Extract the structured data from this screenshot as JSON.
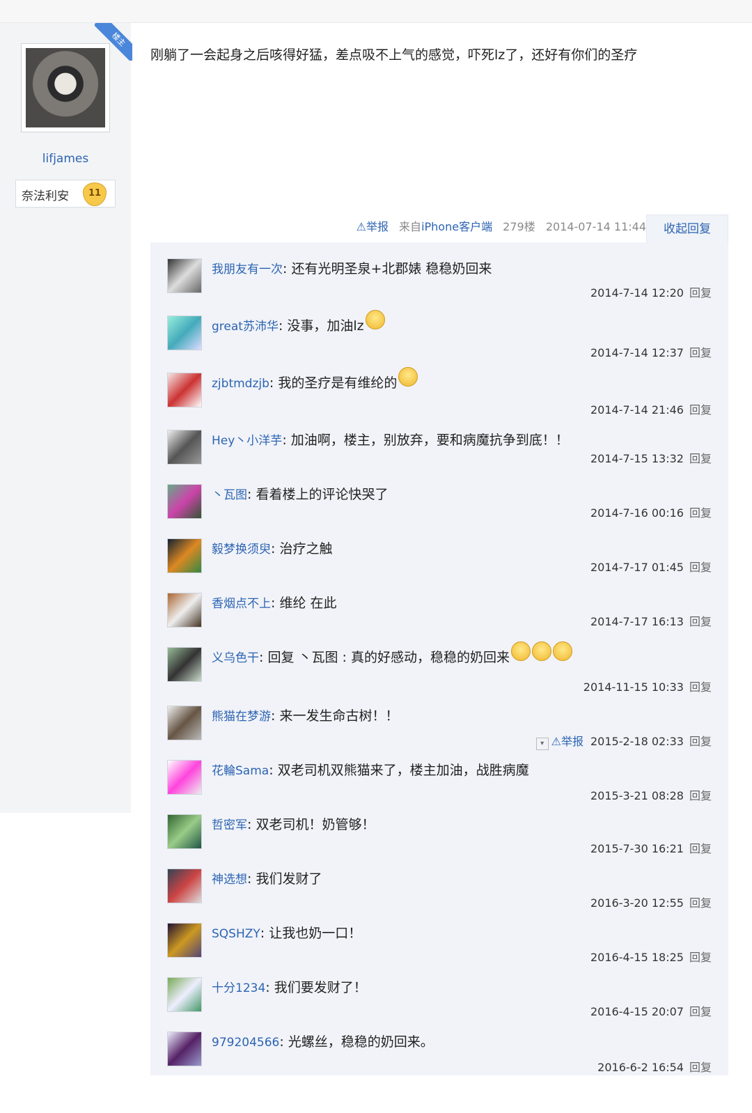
{
  "author": {
    "lz_tag": "楼主",
    "username": "lifjames",
    "badge_name": "奈法利安",
    "badge_level": "11"
  },
  "post": {
    "content": "刚躺了一会起身之后咳得好猛，差点吸不上气的感觉，吓死lz了，还好有你们的圣疗",
    "report": "举报",
    "source_prefix": "来自",
    "source_client": "iPhone客户端",
    "floor": "279楼",
    "time": "2014-07-14 11:44",
    "collapse": "收起回复"
  },
  "reply_label": "回复",
  "replies": [
    {
      "name": "我朋友有一次",
      "text": ": 还有光明圣泉+北郡婊 稳稳奶回来",
      "time": "2014-7-14 12:20"
    },
    {
      "name": "great苏沛华",
      "text": ": 没事，加油lz",
      "time": "2014-7-14 12:37",
      "emoji": "angry-emoji"
    },
    {
      "name": "zjbtmdzjb",
      "text": ": 我的圣疗是有维纶的",
      "time": "2014-7-14 21:46",
      "emoji": "smile-emoji"
    },
    {
      "name": "Hey丶小洋芋",
      "text": ": 加油啊，楼主，别放弃，要和病魔抗争到底！！",
      "time": "2014-7-15 13:32"
    },
    {
      "name": "丶瓦图",
      "text": ": 看着楼上的评论快哭了",
      "time": "2014-7-16 00:16"
    },
    {
      "name": "毅梦换须臾",
      "text": ": 治疗之触",
      "time": "2014-7-17 01:45"
    },
    {
      "name": "香烟点不上",
      "text": ": 维纶 在此",
      "time": "2014-7-17 16:13"
    },
    {
      "name": "义乌色干",
      "text": ": 回复 丶瓦图 : 真的好感动，稳稳的奶回来",
      "time": "2014-11-15 10:33",
      "emoji": "cry-emoji"
    },
    {
      "name": "熊猫在梦游",
      "text": ": 来一发生命古树！！",
      "time": "2015-2-18 02:33",
      "report": "举报"
    },
    {
      "name": "花輪Sama",
      "text": ": 双老司机双熊猫来了，楼主加油，战胜病魔",
      "time": "2015-3-21 08:28"
    },
    {
      "name": "哲密军",
      "text": ": 双老司机！奶管够！",
      "time": "2015-7-30 16:21"
    },
    {
      "name": "神选想",
      "text": ": 我们发财了",
      "time": "2016-3-20 12:55"
    },
    {
      "name": "SQSHZY",
      "text": ": 让我也奶一口！",
      "time": "2016-4-15 18:25"
    },
    {
      "name": "十分1234",
      "text": ": 我们要发财了！",
      "time": "2016-4-15 20:07"
    },
    {
      "name": "979204566",
      "text": ": 光螺丝，稳稳的奶回来。",
      "time": "2016-6-2 16:54"
    }
  ],
  "colors": {
    "link": "#2d64b3",
    "reply_bg": "#f1f3f8",
    "side_bg": "#f3f4f6"
  }
}
